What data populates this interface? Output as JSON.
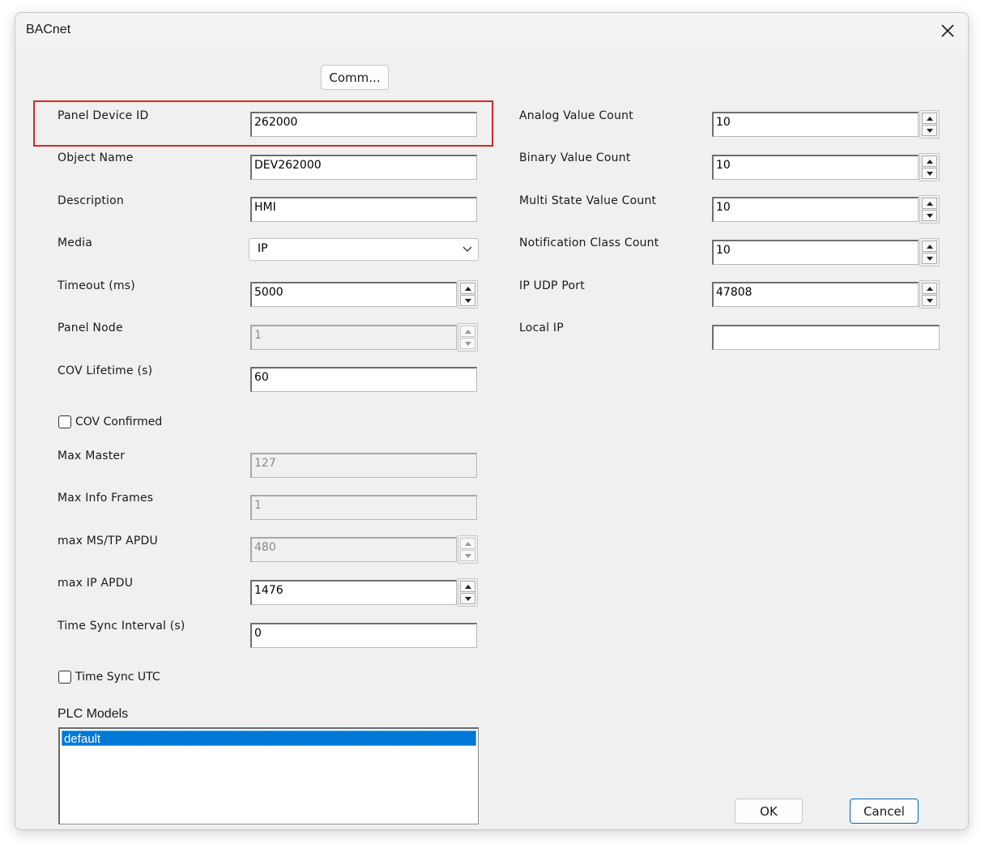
{
  "window": {
    "title": "BACnet"
  },
  "buttons": {
    "comm": "Comm...",
    "ok": "OK",
    "cancel": "Cancel"
  },
  "left": {
    "panel_device_id": {
      "label": "Panel Device ID",
      "value": "262000"
    },
    "object_name": {
      "label": "Object Name",
      "value": "DEV262000"
    },
    "description": {
      "label": "Description",
      "value": "HMI"
    },
    "media": {
      "label": "Media",
      "value": "IP"
    },
    "timeout": {
      "label": "Timeout (ms)",
      "value": "5000"
    },
    "panel_node": {
      "label": "Panel Node",
      "value": "1"
    },
    "cov_lifetime": {
      "label": "COV Lifetime (s)",
      "value": "60"
    },
    "cov_confirmed": {
      "label": "COV Confirmed",
      "checked": false
    },
    "max_master": {
      "label": "Max Master",
      "value": "127"
    },
    "max_info_frames": {
      "label": "Max Info Frames",
      "value": "1"
    },
    "max_mstp_apdu": {
      "label": "max MS/TP APDU",
      "value": "480"
    },
    "max_ip_apdu": {
      "label": "max IP APDU",
      "value": "1476"
    },
    "time_sync_interval": {
      "label": "Time Sync Interval (s)",
      "value": "0"
    },
    "time_sync_utc": {
      "label": "Time Sync UTC",
      "checked": false
    }
  },
  "right": {
    "analog_value_count": {
      "label": "Analog Value Count",
      "value": "10"
    },
    "binary_value_count": {
      "label": "Binary Value Count",
      "value": "10"
    },
    "multi_state_value_count": {
      "label": "Multi State Value Count",
      "value": "10"
    },
    "notification_class_count": {
      "label": "Notification Class Count",
      "value": "10"
    },
    "ip_udp_port": {
      "label": "IP UDP Port",
      "value": "47808"
    },
    "local_ip": {
      "label": "Local IP",
      "value": ""
    }
  },
  "plc_models": {
    "label": "PLC Models",
    "items": [
      "default"
    ],
    "selected": "default"
  },
  "colors": {
    "highlight": "#d9262a",
    "selection": "#0078d7",
    "default_button_border": "#0067c0"
  }
}
